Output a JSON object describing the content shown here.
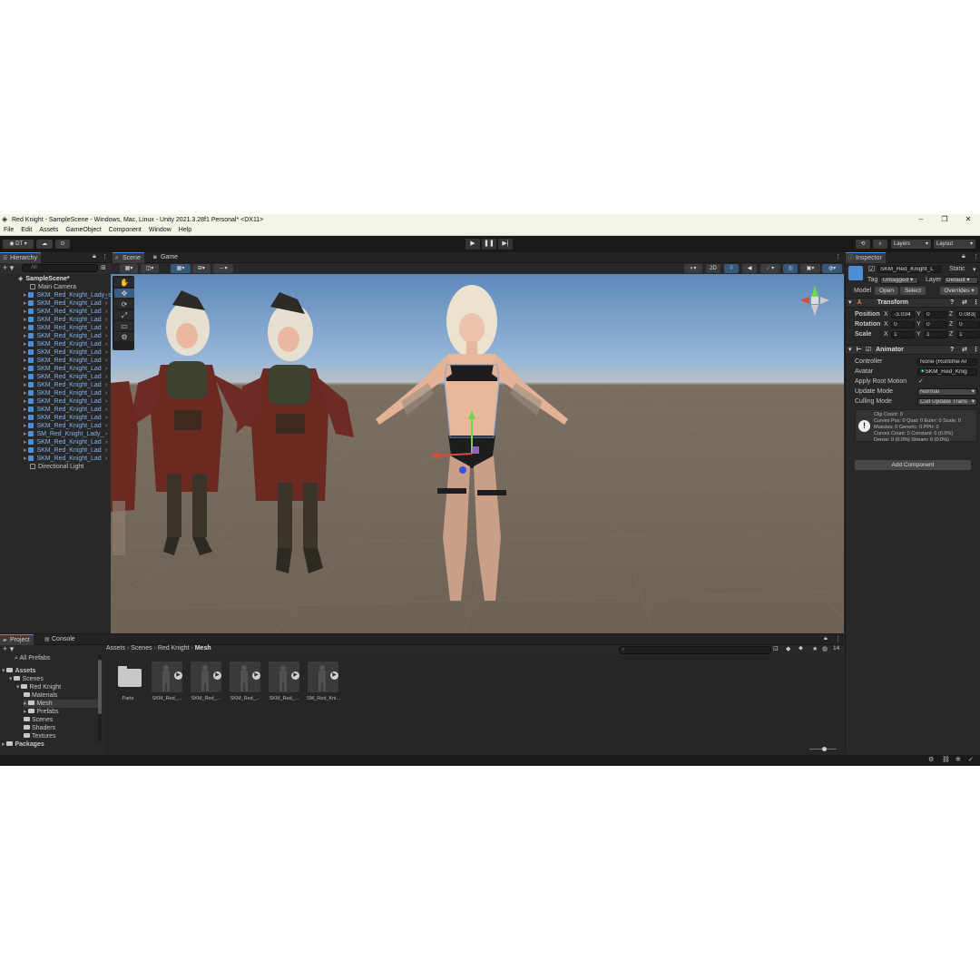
{
  "window": {
    "title": "Red Knight - SampleScene - Windows, Mac, Linux - Unity 2021.3.28f1 Personal* <DX11>",
    "minimize": "–",
    "maximize": "❐",
    "close": "✕"
  },
  "menu": [
    "File",
    "Edit",
    "Assets",
    "GameObject",
    "Component",
    "Window",
    "Help"
  ],
  "toolbar": {
    "account": "DT",
    "layers": "Layers",
    "layout": "Layout",
    "play": "▶",
    "pause": "❚❚",
    "step": "▶|"
  },
  "hierarchy": {
    "tab": "Hierarchy",
    "search_placeholder": "All",
    "scene": "SampleScene*",
    "items": [
      {
        "label": "Main Camera",
        "kind": "gray"
      },
      {
        "label": "SKM_Red_Knight_Lady_s",
        "kind": "blue"
      },
      {
        "label": "SKM_Red_Knight_Lad",
        "kind": "blue"
      },
      {
        "label": "SKM_Red_Knight_Lad",
        "kind": "blue"
      },
      {
        "label": "SKM_Red_Knight_Lad",
        "kind": "blue"
      },
      {
        "label": "SKM_Red_Knight_Lad",
        "kind": "blue"
      },
      {
        "label": "SKM_Red_Knight_Lad",
        "kind": "blue"
      },
      {
        "label": "SKM_Red_Knight_Lad",
        "kind": "blue"
      },
      {
        "label": "SKM_Red_Knight_Lad",
        "kind": "blue"
      },
      {
        "label": "SKM_Red_Knight_Lad",
        "kind": "blue"
      },
      {
        "label": "SKM_Red_Knight_Lad",
        "kind": "blue"
      },
      {
        "label": "SKM_Red_Knight_Lad",
        "kind": "blue"
      },
      {
        "label": "SKM_Red_Knight_Lad",
        "kind": "blue"
      },
      {
        "label": "SKM_Red_Knight_Lad",
        "kind": "blue"
      },
      {
        "label": "SKM_Red_Knight_Lad",
        "kind": "blue"
      },
      {
        "label": "SKM_Red_Knight_Lad",
        "kind": "blue"
      },
      {
        "label": "SKM_Red_Knight_Lad",
        "kind": "blue"
      },
      {
        "label": "SKM_Red_Knight_Lad",
        "kind": "blue"
      },
      {
        "label": "SM_Red_Knight_Lady_",
        "kind": "blue"
      },
      {
        "label": "SKM_Red_Knight_Lad",
        "kind": "blue"
      },
      {
        "label": "SKM_Red_Knight_Lad",
        "kind": "blue"
      },
      {
        "label": "SKM_Red_Knight_Lad",
        "kind": "blue"
      },
      {
        "label": "Directional Light",
        "kind": "gray"
      }
    ]
  },
  "scene_view": {
    "tabs": [
      "Scene",
      "Game"
    ],
    "mode_2d": "2D",
    "tools": [
      "✋",
      "✥",
      "⟳",
      "⤢",
      "▭",
      "⚙"
    ]
  },
  "inspector": {
    "tab": "Inspector",
    "object_name": "SKM_Red_Knight_L",
    "static_label": "Static",
    "tag_label": "Tag",
    "tag_value": "Untagged",
    "layer_label": "Layer",
    "layer_value": "Default",
    "model_label": "Model",
    "open": "Open",
    "select": "Select",
    "overrides": "Overrides",
    "transform": {
      "title": "Transform",
      "position_label": "Position",
      "rotation_label": "Rotation",
      "scale_label": "Scale",
      "x": "X",
      "y": "Y",
      "z": "Z",
      "position": [
        "-3.034",
        "0",
        "0.083("
      ],
      "rotation": [
        "0",
        "0",
        "0"
      ],
      "scale": [
        "1",
        "1",
        "1"
      ]
    },
    "animator": {
      "title": "Animator",
      "controller_label": "Controller",
      "controller_value": "None (Runtime Ar",
      "avatar_label": "Avatar",
      "avatar_value": "SKM_Red_Knig",
      "apply_root_label": "Apply Root Motion",
      "update_mode_label": "Update Mode",
      "update_mode_value": "Normal",
      "culling_mode_label": "Culling Mode",
      "culling_mode_value": "Cull Update Trans",
      "info": [
        "Clip Count: 0",
        "Curves Pos: 0 Quat: 0 Euler: 0 Scale: 0",
        "Muscles: 0 Generic: 0 PPtr: 0",
        "Curves Count: 0 Constant: 0 (0.0%)",
        "Dense: 0 (0.0%) Stream: 0 (0.0%)"
      ]
    },
    "add_component": "Add Component"
  },
  "project": {
    "tabs": [
      "Project",
      "Console"
    ],
    "favorites": "All Prefabs",
    "tree": [
      {
        "label": "Assets",
        "indent": 0,
        "bold": true
      },
      {
        "label": "Scenes",
        "indent": 1,
        "bold": false
      },
      {
        "label": "Red Knight",
        "indent": 2,
        "bold": false
      },
      {
        "label": "Materials",
        "indent": 3,
        "bold": false
      },
      {
        "label": "Mesh",
        "indent": 3,
        "bold": false
      },
      {
        "label": "Prefabs",
        "indent": 3,
        "bold": false
      },
      {
        "label": "Scenes",
        "indent": 3,
        "bold": false
      },
      {
        "label": "Shaders",
        "indent": 3,
        "bold": false
      },
      {
        "label": "Textures",
        "indent": 3,
        "bold": false
      },
      {
        "label": "Packages",
        "indent": 0,
        "bold": true
      }
    ],
    "breadcrumb": [
      "Assets",
      "Scenes",
      "Red Knight",
      "Mesh"
    ],
    "count": "14",
    "assets": [
      "Parts",
      "SKM_Red_...",
      "SKM_Red_...",
      "SKM_Red_...",
      "SKM_Red_...",
      "SM_Red_Kni..."
    ]
  }
}
